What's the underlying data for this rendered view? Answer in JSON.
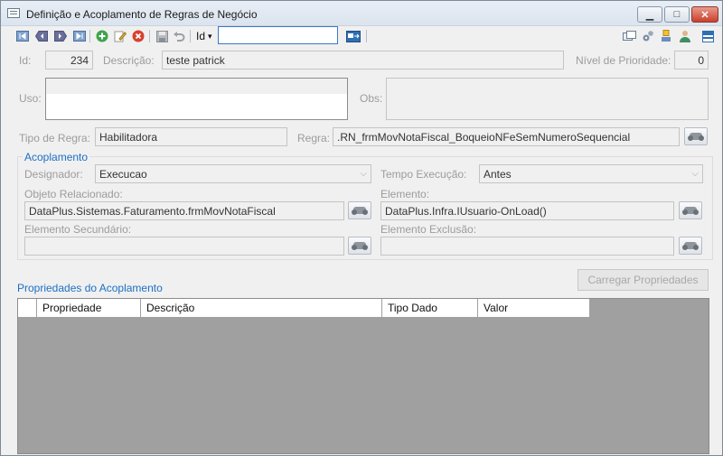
{
  "window": {
    "title": "Definição e Acoplamento de Regras de Negócio",
    "minimize_glyph": "▁",
    "maximize_glyph": "□",
    "close_glyph": "✕"
  },
  "toolbar": {
    "search_field_label": "Id",
    "search_value": "",
    "dropdown_glyph": "▾"
  },
  "form": {
    "id_label": "Id:",
    "id_value": "234",
    "descricao_label": "Descrição:",
    "descricao_value": "teste patrick",
    "prioridade_label": "Nível de Prioridade:",
    "prioridade_value": "0",
    "uso_label": "Uso:",
    "uso_value": "",
    "obs_label": "Obs:",
    "obs_value": "",
    "tipo_regra_label": "Tipo de Regra:",
    "tipo_regra_value": "Habilitadora",
    "regra_label": "Regra:",
    "regra_value": ".RN_frmMovNotaFiscal_BoqueioNFeSemNumeroSequencial"
  },
  "acoplamento": {
    "title": "Acoplamento",
    "designador_label": "Designador:",
    "designador_value": "Execucao",
    "tempo_label": "Tempo Execução:",
    "tempo_value": "Antes",
    "objeto_label": "Objeto Relacionado:",
    "objeto_value": "DataPlus.Sistemas.Faturamento.frmMovNotaFiscal",
    "elemento_label": "Elemento:",
    "elemento_value": "DataPlus.Infra.IUsuario-OnLoad()",
    "secundario_label": "Elemento Secundário:",
    "secundario_value": "",
    "exclusao_label": "Elemento Exclusão:",
    "exclusao_value": ""
  },
  "propriedades": {
    "title": "Propriedades do Acoplamento",
    "load_button": "Carregar Propriedades",
    "columns": [
      "",
      "Propriedade",
      "Descrição",
      "Tipo Dado",
      "Valor"
    ]
  },
  "colors": {
    "accent": "#1c6fc4",
    "grid_background": "#a0a0a0"
  }
}
